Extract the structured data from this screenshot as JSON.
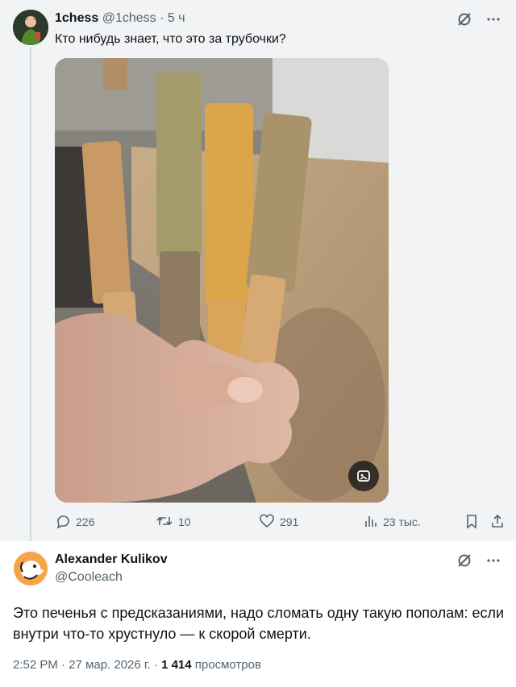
{
  "original_tweet": {
    "display_name": "1chess",
    "handle": "@1chess",
    "time_ago": "5 ч",
    "text": "Кто нибудь знает, что это за трубочки?",
    "actions": {
      "replies": "226",
      "retweets": "10",
      "likes": "291",
      "views": "23 тыс."
    }
  },
  "reply_tweet": {
    "display_name": "Alexander Kulikov",
    "handle": "@Cooleach",
    "text": "Это печенья с предсказаниями, надо сломать одну такую пополам: если внутри что-то хрустнуло — к скорой смерти.",
    "timestamp": "2:52 PM · 27 мар. 2026 г. · ",
    "views_count": "1 414",
    "views_label": " просмотров"
  },
  "icons": {
    "grok": "grok-icon",
    "more": "more-dots-icon",
    "reply": "reply-bubble-icon",
    "retweet": "retweet-icon",
    "like": "heart-icon",
    "views": "bar-chart-icon",
    "bookmark": "bookmark-icon",
    "share": "share-icon",
    "alt": "image-edit-icon"
  },
  "colors": {
    "text": "#0f1419",
    "secondary": "#536471",
    "top_background": "#f2f3f4"
  }
}
